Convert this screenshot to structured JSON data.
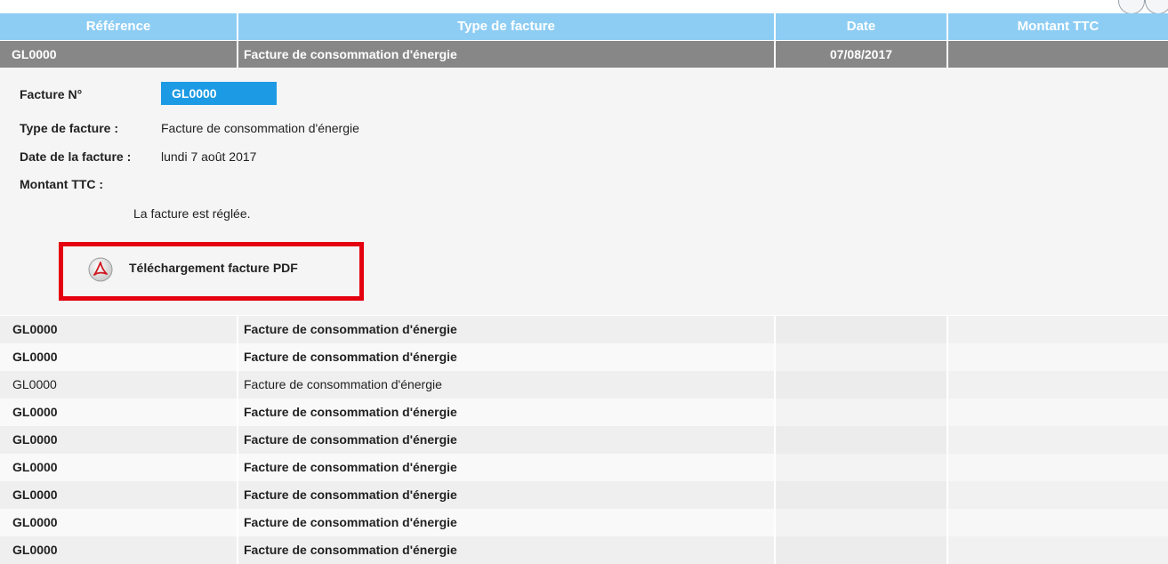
{
  "header": {
    "columns": [
      "Référence",
      "Type de facture",
      "Date",
      "Montant TTC"
    ]
  },
  "selected": {
    "reference": "GL0000",
    "type": "Facture de consommation d'énergie",
    "date": "07/08/2017",
    "amount": ""
  },
  "detail": {
    "number_label": "Facture N°",
    "number_value": "GL0000",
    "type_label": "Type de facture :",
    "type_value": "Facture de consommation d'énergie",
    "date_label": "Date de la facture :",
    "date_value": "lundi 7 août 2017",
    "amount_label": "Montant TTC :",
    "amount_value": "",
    "status": "La facture est réglée.",
    "download_label": "Téléchargement facture PDF",
    "download_icon": "pdf-icon"
  },
  "rows": [
    {
      "reference": "GL0000",
      "type": "Facture de consommation d'énergie",
      "bold": true
    },
    {
      "reference": "GL0000",
      "type": "Facture de consommation d'énergie",
      "bold": true
    },
    {
      "reference": "GL0000",
      "type": "Facture de consommation d'énergie",
      "bold": false
    },
    {
      "reference": "GL0000",
      "type": "Facture de consommation d'énergie",
      "bold": true
    },
    {
      "reference": "GL0000",
      "type": "Facture de consommation d'énergie",
      "bold": true
    },
    {
      "reference": "GL0000",
      "type": "Facture de consommation d'énergie",
      "bold": true
    },
    {
      "reference": "GL0000",
      "type": "Facture de consommation d'énergie",
      "bold": true
    },
    {
      "reference": "GL0000",
      "type": "Facture de consommation d'énergie",
      "bold": true
    },
    {
      "reference": "GL0000",
      "type": "Facture de consommation d'énergie",
      "bold": true
    }
  ],
  "colors": {
    "header_bg": "#8dcdf4",
    "selected_bg": "#878787",
    "badge_bg": "#1d9ae4",
    "highlight_border": "#e4000f"
  }
}
